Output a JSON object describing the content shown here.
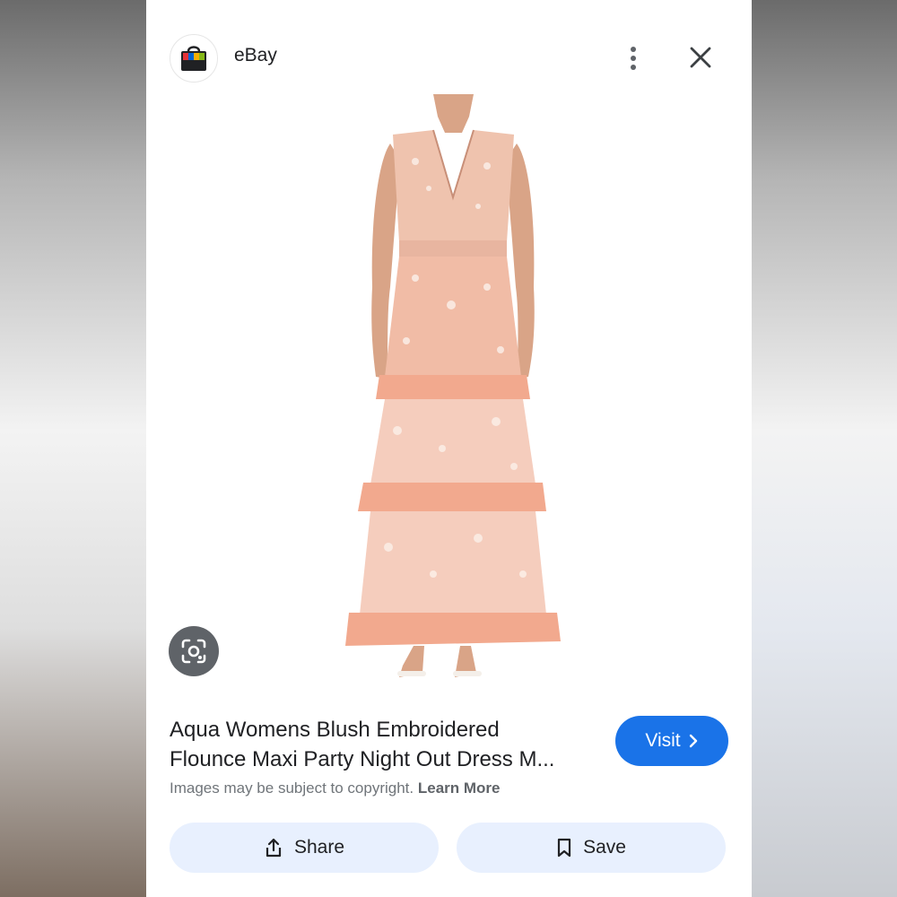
{
  "header": {
    "site_name": "eBay",
    "logo_icon": "ebay-shopping-bag-icon",
    "more_icon": "more-vert-icon",
    "close_icon": "close-icon"
  },
  "image": {
    "subject": "product-photo-icon",
    "lens_icon": "google-lens-icon"
  },
  "result": {
    "title_line1": "Aqua Womens Blush Embroidered",
    "title_line2": "Flounce Maxi Party Night Out Dress M...",
    "visit_label": "Visit",
    "copyright_text": "Images may be subject to copyright.",
    "learn_more_label": "Learn More"
  },
  "actions": {
    "share_label": "Share",
    "save_label": "Save"
  },
  "colors": {
    "accent": "#1a73e8",
    "action_bg": "#e8f0fe",
    "dress": "#f2b7a0"
  }
}
